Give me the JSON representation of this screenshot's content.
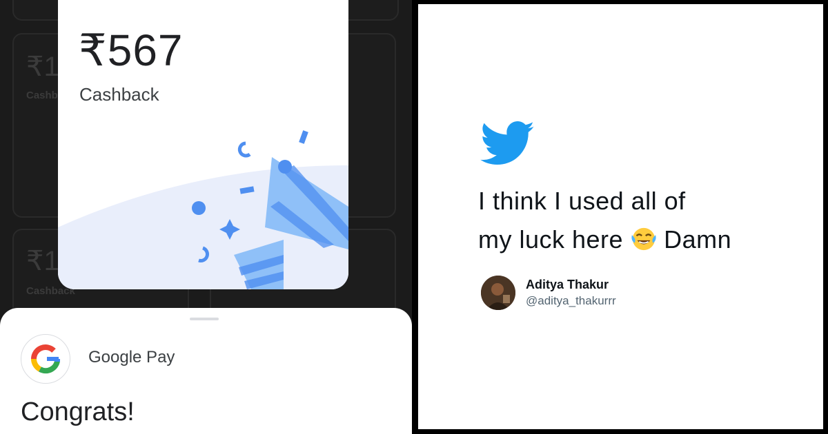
{
  "background_cards": [
    {
      "amount": "₹1",
      "label": "Cashb"
    },
    {
      "amount": "₹1",
      "label": "Cashback"
    }
  ],
  "reward": {
    "amount": "₹567",
    "label": "Cashback"
  },
  "sheet": {
    "app_name": "Google Pay",
    "message": "Congrats!",
    "icon": "google-g-icon"
  },
  "tweet": {
    "text_line1": "I think I used all of",
    "text_line2_before": "my luck here",
    "text_line2_after": "Damn",
    "emoji": "face-with-tears-of-joy-icon",
    "author": {
      "name": "Aditya Thakur",
      "handle": "@aditya_thakurrr"
    },
    "brand_icon": "twitter-bird-icon"
  },
  "colors": {
    "twitter_blue": "#1d9bf0",
    "confetti_blue": "#4f8ff0",
    "confetti_light": "#8fc0f8",
    "card_bg_tint": "#e9eefb"
  }
}
